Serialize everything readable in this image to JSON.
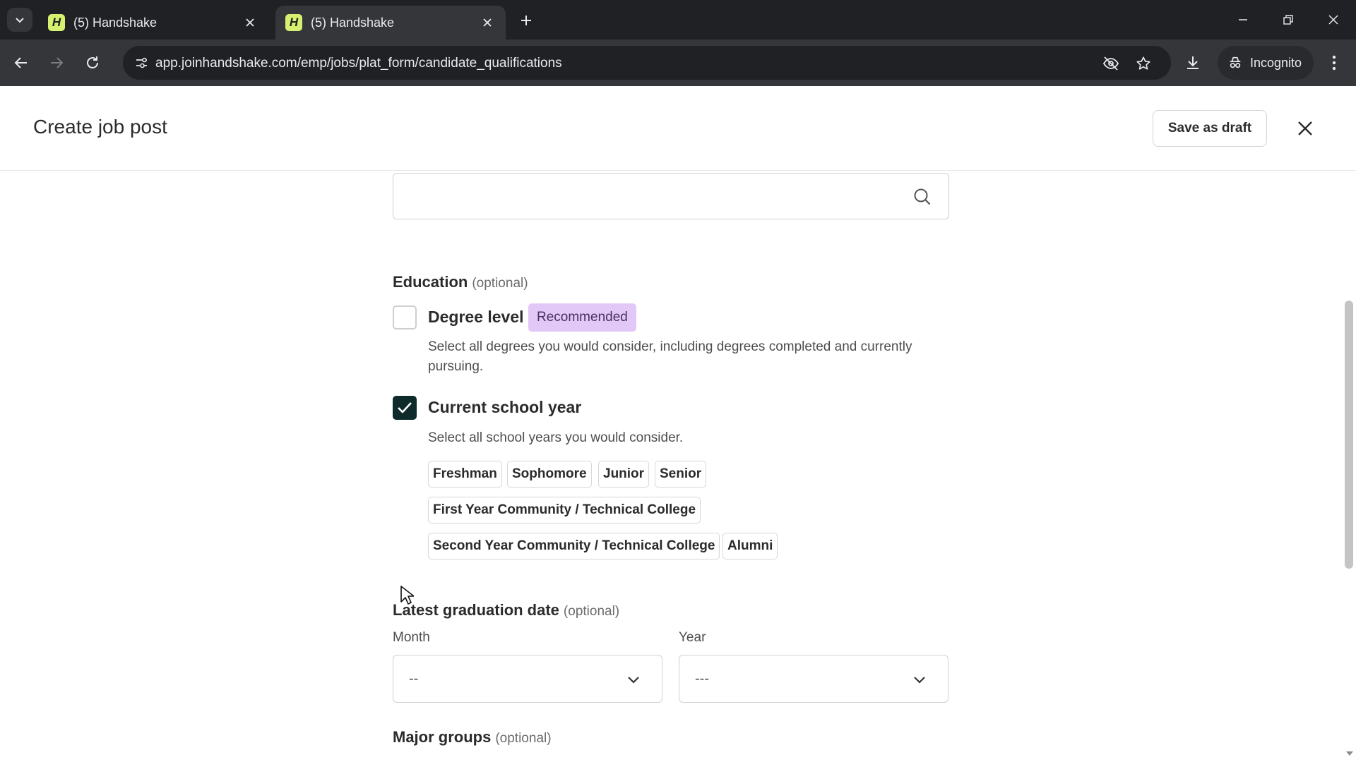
{
  "browser": {
    "tabs": [
      {
        "title": "(5) Handshake",
        "favicon": "H",
        "active": false
      },
      {
        "title": "(5) Handshake",
        "favicon": "H",
        "active": true
      }
    ],
    "url": "app.joinhandshake.com/emp/jobs/plat_form/candidate_qualifications",
    "profile_label": "Incognito",
    "icons": [
      "tab-search-icon",
      "close-icon",
      "plus-icon",
      "minimize-icon",
      "restore-icon",
      "back-icon",
      "forward-icon",
      "reload-icon",
      "site-info-icon",
      "eye-off-icon",
      "star-icon",
      "download-icon",
      "incognito-icon",
      "kebab-menu-icon"
    ]
  },
  "header": {
    "title": "Create job post",
    "save_draft_label": "Save as draft"
  },
  "form": {
    "search": {
      "value": "",
      "placeholder": ""
    },
    "education": {
      "title": "Education",
      "optional": "(optional)",
      "degree_level": {
        "label": "Degree level",
        "checked": false,
        "badge": "Recommended",
        "help": "Select all degrees you would consider, including degrees completed and currently pursuing."
      },
      "school_year": {
        "label": "Current school year",
        "checked": true,
        "help": "Select all school years you would consider.",
        "chips": [
          "Freshman",
          "Sophomore",
          "Junior",
          "Senior",
          "First Year Community / Technical College",
          "Second Year Community / Technical College",
          "Alumni"
        ]
      }
    },
    "graduation": {
      "title": "Latest graduation date",
      "optional": "(optional)",
      "month_label": "Month",
      "month_value": "--",
      "year_label": "Year",
      "year_value": "---"
    },
    "major_groups": {
      "title": "Major groups",
      "optional": "(optional)"
    }
  },
  "colors": {
    "chrome_dark": "#202124",
    "chrome_toolbar": "#35363a",
    "favicon": "#d6f06f",
    "checkbox_checked": "#0f2a2a",
    "badge_bg": "#e2c8f7"
  }
}
